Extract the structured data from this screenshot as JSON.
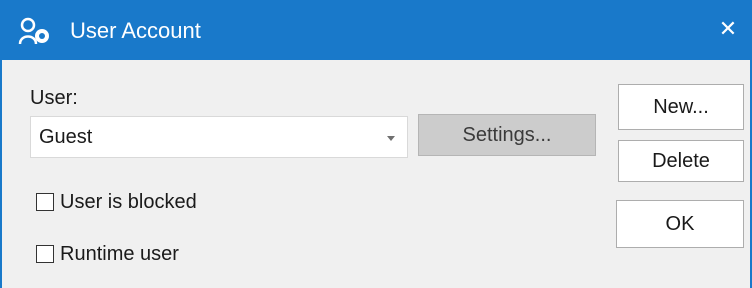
{
  "window": {
    "title": "User Account",
    "close_symbol": "✕",
    "colors": {
      "titlebar": "#1979ca",
      "body": "#f0f0f0"
    }
  },
  "form": {
    "user_label": "User:",
    "user_selected": "Guest",
    "settings_label": "Settings...",
    "blocked_label": "User is blocked",
    "blocked_checked": false,
    "runtime_label": "Runtime user",
    "runtime_checked": false
  },
  "buttons": {
    "new_label": "New...",
    "delete_label": "Delete",
    "ok_label": "OK"
  },
  "icons": {
    "title": "user-account-icon",
    "close": "close-icon",
    "dropdown": "chevron-down-icon"
  }
}
